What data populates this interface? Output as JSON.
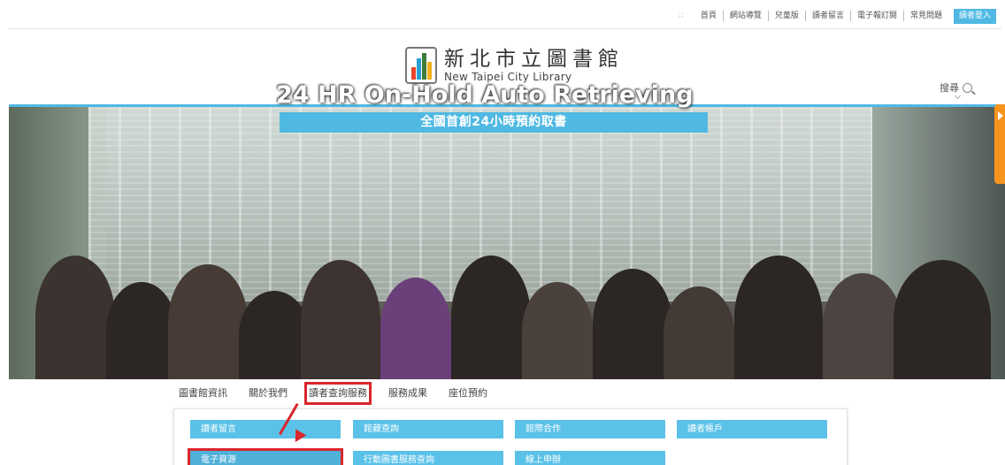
{
  "topbar": {
    "links": [
      "首頁",
      "網站導覽",
      "兒童版",
      "讀者留言",
      "電子報訂閱",
      "常見問題"
    ],
    "login_label": "讀者登入"
  },
  "logo": {
    "name_zh": "新北市立圖書館",
    "name_en": "New Taipei City Library"
  },
  "search": {
    "label": "搜尋"
  },
  "hero": {
    "title": "24 HR On-Hold Auto Retrieving",
    "subtitle": "全國首創24小時預約取書"
  },
  "nav": {
    "items": [
      "圖書館資訊",
      "關於我們",
      "讀者查詢服務",
      "服務成果",
      "座位預約"
    ]
  },
  "dropdown": {
    "row1": [
      "讀者留言",
      "館藏查詢",
      "館際合作",
      "讀者帳戶"
    ],
    "row2": [
      "電子資源",
      "行動圖書服務查詢",
      "線上申辦"
    ]
  },
  "colors": {
    "accent": "#4fb9e3",
    "highlight": "#d9262b",
    "side_tab": "#f7941d"
  }
}
